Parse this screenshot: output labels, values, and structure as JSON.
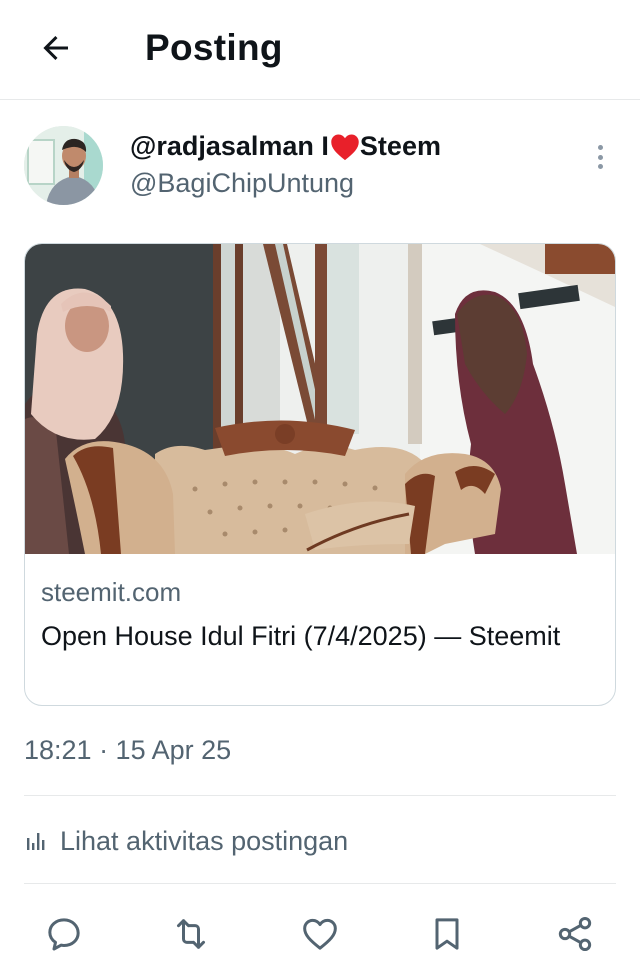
{
  "header": {
    "title": "Posting"
  },
  "author": {
    "display_name_before": "@radjasalman I",
    "display_name_after": "Steem",
    "handle": "@BagiChipUntung"
  },
  "card": {
    "domain": "steemit.com",
    "title": "Open House Idul Fitri (7/4/2025) — Steemit"
  },
  "timestamp": "18:21 · 15 Apr 25",
  "activity_label": "Lihat aktivitas postingan",
  "colors": {
    "text": "#0f1419",
    "secondary": "#536471",
    "border": "#cfd9de",
    "heart": "#f91880"
  },
  "icons": [
    "back-arrow-icon",
    "heart-emoji-icon",
    "more-dots-icon",
    "analytics-icon",
    "reply-icon",
    "retweet-icon",
    "like-icon",
    "bookmark-icon",
    "share-icon"
  ]
}
